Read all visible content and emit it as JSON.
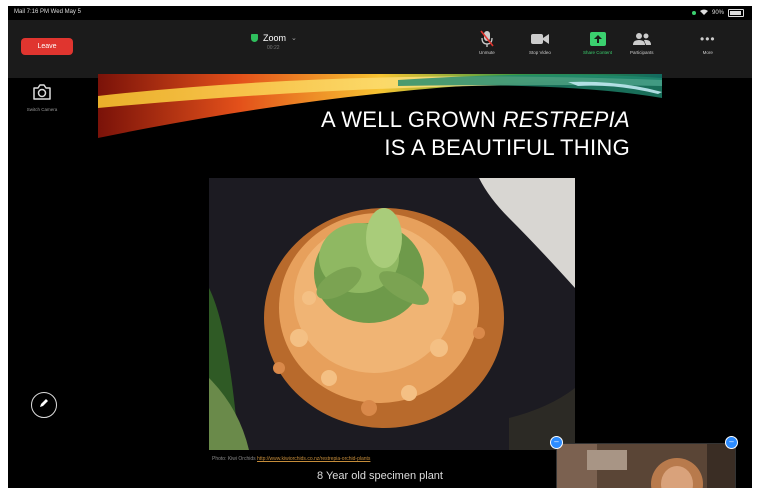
{
  "status_bar": {
    "left": "Mail  7:16 PM  Wed May 5",
    "right": "90%"
  },
  "toolbar": {
    "leave_label": "Leave",
    "meeting_title": "Zoom",
    "meeting_subtitle": "00:22",
    "items": [
      {
        "label": "Unmute",
        "icon": "microphone-muted-icon"
      },
      {
        "label": "Stop Video",
        "icon": "video-camera-icon"
      },
      {
        "label": "Share Content",
        "icon": "share-screen-icon"
      },
      {
        "label": "Participants",
        "icon": "participants-icon"
      },
      {
        "label": "More",
        "icon": "more-icon"
      }
    ]
  },
  "left_panel": {
    "switch_camera_label": "Switch Camera"
  },
  "slide": {
    "title_line1_prefix": "A WELL GROWN ",
    "title_line1_italic": "RESTREPIA",
    "title_line2": "IS A BEAUTIFUL THING",
    "caption_prefix": "Photo: Kiwi Orchids",
    "caption_link": "http://www.kiwiorchids.co.nz/restrepia-orchid-plants",
    "subcaption": "8 Year old specimen plant"
  },
  "colors": {
    "leave": "#e0352f",
    "accent_green": "#3bd16f",
    "toolbar_bg": "#1b1b1b",
    "badge_blue": "#2d8cff"
  }
}
